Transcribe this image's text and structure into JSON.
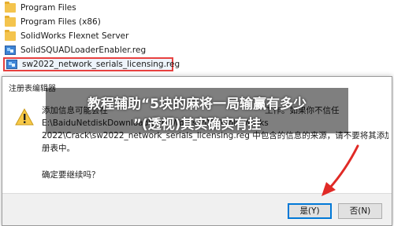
{
  "explorer": {
    "items": [
      {
        "name": "Program Files",
        "type": "folder",
        "icon": "folder-icon"
      },
      {
        "name": "Program Files (x86)",
        "type": "folder",
        "icon": "folder-icon"
      },
      {
        "name": "SolidWorks Flexnet Server",
        "type": "folder",
        "icon": "folder-icon"
      },
      {
        "name": "SolidSQUADLoaderEnabler.reg",
        "type": "reg",
        "icon": "registry-file-icon"
      },
      {
        "name": "sw2022_network_serials_licensing.reg",
        "type": "reg",
        "icon": "registry-file-icon",
        "selected": true
      }
    ]
  },
  "dialog": {
    "title": "注册表编辑器",
    "icon": "warning-icon",
    "message_lines": [
      "添加信息可能会在",
      "E:\\BaiduNetdiskDownload\\SolidWorks 2022\\SolidWorks",
      "2022\\Crack\\sw2022_network_serials_licensing.reg 中包含的信息的来源，请不要将其添加到注",
      "册表中。"
    ],
    "message_right_fragment": "工作。如果你不信任",
    "confirm_text": "确定要继续吗？",
    "buttons": {
      "yes": "是(Y)",
      "no": "否(N)"
    }
  },
  "overlay": {
    "line1": "教程辅助“5块的麻将一局输赢有多少",
    "line2": "”(透视)其实确实有挂"
  },
  "colors": {
    "selection_border": "#e8413f",
    "arrow": "#e02a26",
    "button_focus": "#0078d7"
  }
}
